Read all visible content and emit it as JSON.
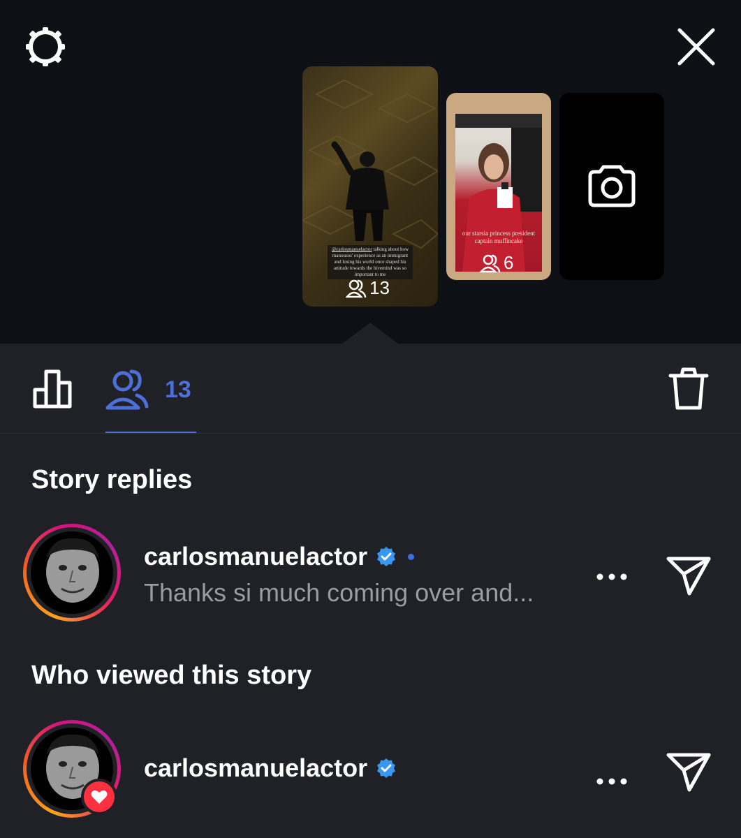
{
  "header": {
    "settings_icon": "gear-icon",
    "close_icon": "close-icon"
  },
  "stories": [
    {
      "caption_handle": "@carlosmanuelactor",
      "caption_text": "talking about how manousos' experience as an immigrant and losing his world once shaped his attitude towards the hivemind was so important to me",
      "viewers": "13"
    },
    {
      "caption_text": "our starsia princess president captain muffincake",
      "viewers": "6"
    },
    {
      "type": "add-story",
      "icon": "camera-icon"
    }
  ],
  "tabs": {
    "insights_icon": "bar-chart-icon",
    "viewers_icon": "viewers-icon",
    "viewers_count": "13",
    "delete_icon": "trash-icon"
  },
  "story_replies": {
    "title": "Story replies",
    "items": [
      {
        "username": "carlosmanuelactor",
        "verified": true,
        "unread": true,
        "message": "Thanks si much coming over and..."
      }
    ]
  },
  "viewers": {
    "title": "Who viewed this story",
    "items": [
      {
        "username": "carlosmanuelactor",
        "verified": true,
        "liked": true
      }
    ]
  },
  "colors": {
    "accent": "#4d6fd8",
    "verified": "#3897f0",
    "heart": "#ff3040",
    "background": "#202126",
    "top_background": "#0d1014"
  }
}
